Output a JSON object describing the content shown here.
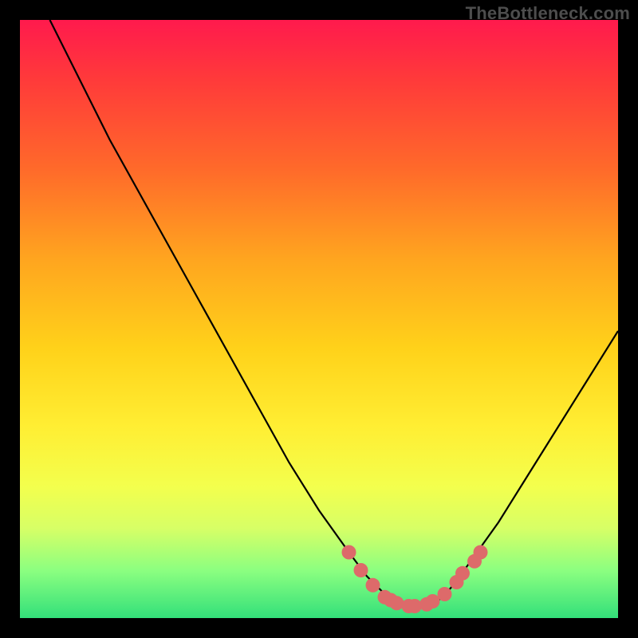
{
  "watermark": "TheBottleneck.com",
  "chart_data": {
    "type": "line",
    "title": "",
    "xlabel": "",
    "ylabel": "",
    "xlim": [
      0,
      100
    ],
    "ylim": [
      0,
      100
    ],
    "grid": false,
    "legend": false,
    "series": [
      {
        "name": "bottleneck-curve",
        "x": [
          5,
          10,
          15,
          20,
          25,
          30,
          35,
          40,
          45,
          50,
          55,
          58,
          60,
          62,
          65,
          68,
          70,
          72,
          75,
          80,
          85,
          90,
          95,
          100
        ],
        "y": [
          100,
          90,
          80,
          71,
          62,
          53,
          44,
          35,
          26,
          18,
          11,
          7,
          5,
          3,
          2,
          2,
          3,
          5,
          9,
          16,
          24,
          32,
          40,
          48
        ]
      }
    ],
    "markers": {
      "name": "highlight-dots",
      "color": "#dd6a6a",
      "x": [
        55,
        57,
        59,
        61,
        62,
        63,
        65,
        66,
        68,
        69,
        71,
        73,
        74,
        76,
        77
      ],
      "y": [
        11,
        8,
        5.5,
        3.5,
        3,
        2.5,
        2,
        2,
        2.3,
        2.8,
        4,
        6,
        7.5,
        9.5,
        11
      ]
    }
  }
}
